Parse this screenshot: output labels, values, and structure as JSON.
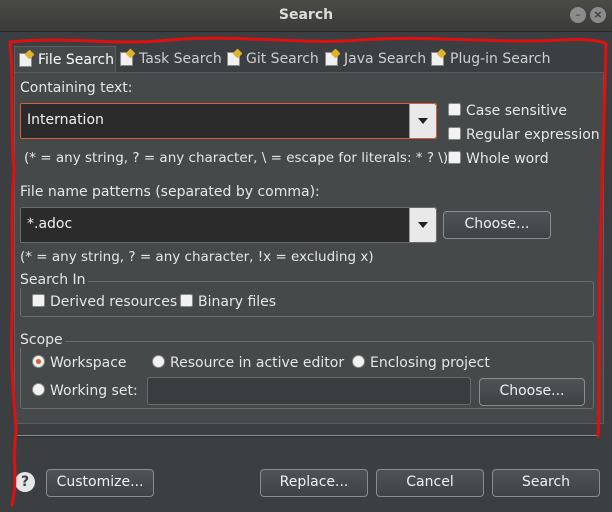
{
  "window": {
    "title": "Search",
    "minimize_glyph": "–",
    "close_glyph": "×"
  },
  "tabs": [
    {
      "label": "File Search",
      "icon": "file-search-icon"
    },
    {
      "label": "Task Search",
      "icon": "task-search-icon"
    },
    {
      "label": "Git Search",
      "icon": "git-search-icon"
    },
    {
      "label": "Java Search",
      "icon": "java-search-icon"
    },
    {
      "label": "Plug-in Search",
      "icon": "plugin-search-icon"
    }
  ],
  "containing": {
    "label": "Containing text:",
    "value": "Internation",
    "hint": "(* = any string, ? = any character, \\ = escape for literals: * ? \\)"
  },
  "options": {
    "case_sensitive": "Case sensitive",
    "regular_expression": "Regular expression",
    "whole_word": "Whole word"
  },
  "file_patterns": {
    "label": "File name patterns (separated by comma):",
    "value": "*.adoc",
    "choose": "Choose...",
    "hint": "(* = any string, ? = any character, !x = excluding x)"
  },
  "search_in": {
    "label": "Search In",
    "derived": "Derived resources",
    "binary": "Binary files"
  },
  "scope": {
    "label": "Scope",
    "workspace": "Workspace",
    "active_editor": "Resource in active editor",
    "enclosing_project": "Enclosing project",
    "working_set": "Working set:",
    "working_set_value": "",
    "choose": "Choose..."
  },
  "footer": {
    "help": "?",
    "customize": "Customize...",
    "replace": "Replace...",
    "cancel": "Cancel",
    "search": "Search"
  },
  "colors": {
    "annotation": "#e01010",
    "radio_selected": "#e05a2b",
    "focus_border": "#d35f3f"
  }
}
